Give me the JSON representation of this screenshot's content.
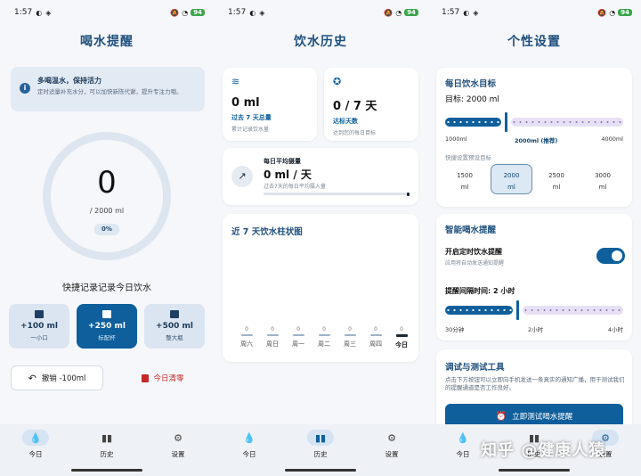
{
  "status": {
    "time": "1:57",
    "battery": "94"
  },
  "today": {
    "title": "喝水提醒",
    "tip_title": "多喝温水，保持活力",
    "tip_desc": "定时适量补充水分，可以加快新陈代谢，提升专注力哦。",
    "tip_icon": "info-icon",
    "current": "0",
    "goal": "/ 2000 ml",
    "percent": "0%",
    "progress_fraction": 0,
    "quick_title": "快捷记录记录今日饮水",
    "quick": [
      {
        "value": "+100 ml",
        "label": "一小口",
        "icon": "cup-icon"
      },
      {
        "value": "+250 ml",
        "label": "标配杯",
        "icon": "glass-icon"
      },
      {
        "value": "+500 ml",
        "label": "整大瓶",
        "icon": "bottle-icon"
      }
    ],
    "undo": "撤销 -100ml",
    "clear": "今日清零"
  },
  "history": {
    "title": "饮水历史",
    "stat1": {
      "value": "0 ml",
      "label": "过去 7 天总量",
      "desc": "累计记录饮水量",
      "icon": "waves-icon"
    },
    "stat2": {
      "value": "0 / 7 天",
      "label": "达标天数",
      "desc": "达到您的每日目标",
      "icon": "star-icon"
    },
    "avg": {
      "label": "每日平均摄量",
      "value": "0 ml / 天",
      "desc": "过去7天的每日平均摄入量",
      "icon": "trend-icon"
    },
    "chart_title": "近 7 天饮水柱状图"
  },
  "chart_data": {
    "type": "bar",
    "categories": [
      "周六",
      "周日",
      "周一",
      "周二",
      "周三",
      "周四",
      "今日"
    ],
    "values": [
      0,
      0,
      0,
      0,
      0,
      0,
      0
    ],
    "title": "近 7 天饮水柱状图"
  },
  "settings": {
    "title": "个性设置",
    "goal_section": "每日饮水目标",
    "goal_value": "目标: 2000 ml",
    "goal_min": "1000ml",
    "goal_mid": "2000ml (推荐)",
    "goal_max": "4000ml",
    "goal_fraction": 0.333,
    "preset_label": "快捷设置预设目标",
    "presets": [
      {
        "v": "1500",
        "u": "ml"
      },
      {
        "v": "2000",
        "u": "ml"
      },
      {
        "v": "2500",
        "u": "ml"
      },
      {
        "v": "3000",
        "u": "ml"
      }
    ],
    "remind_section": "智能喝水提醒",
    "remind_toggle": "开启定时饮水提醒",
    "remind_desc": "应用将自动发送通知提醒",
    "interval_label": "提醒间隔时间: 2 小时",
    "interval_min": "30分钟",
    "interval_mid": "2小时",
    "interval_max": "4小时",
    "interval_fraction": 0.4,
    "test_section": "调试与测试工具",
    "test_desc": "点击下方按钮可以立即向手机发送一条真实的通知广播，用于测试我们的提醒通道是否工作良好。",
    "test_button": "立即测试喝水提醒"
  },
  "nav": {
    "today": "今日",
    "history": "历史",
    "settings": "设置"
  },
  "watermark": "知乎 @健康人猿"
}
